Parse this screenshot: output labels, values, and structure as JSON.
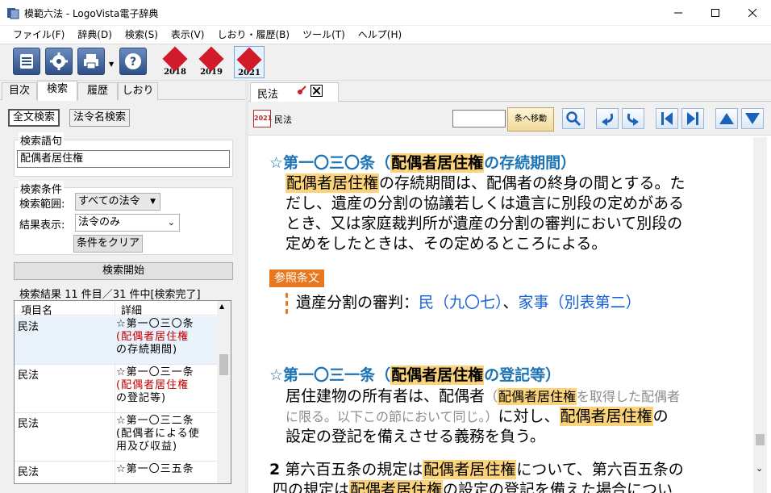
{
  "window": {
    "title": "模範六法 - LogoVista電子辞典",
    "controls": {
      "minimize": "—",
      "maximize": "☐",
      "close": "✕"
    }
  },
  "menu": [
    "ファイル(F)",
    "辞典(D)",
    "検索(S)",
    "表示(V)",
    "しおり・履歴(B)",
    "ツール(T)",
    "ヘルプ(H)"
  ],
  "toolbar": {
    "editions": [
      {
        "label": "模範六法",
        "year": "2018",
        "active": false
      },
      {
        "label": "模範六法",
        "year": "2019",
        "active": false
      },
      {
        "label": "模範六法",
        "year": "2021",
        "active": true
      }
    ],
    "icons": [
      "list-icon",
      "gear-icon",
      "printer-icon",
      "help-icon"
    ],
    "accent_color": "#2e4f86"
  },
  "left": {
    "tabs": [
      "目次",
      "検索",
      "履歴",
      "しおり"
    ],
    "active_tab": "検索",
    "subtabs": [
      "全文検索",
      "法令名検索"
    ],
    "active_subtab": "全文検索",
    "query_group": {
      "label": "検索語句",
      "value": "配偶者居住権"
    },
    "conditions": {
      "label": "検索条件",
      "range_label": "検索範囲:",
      "range_value": "すべての法令",
      "display_label": "結果表示:",
      "display_value": "法令のみ",
      "clear_button": "条件をクリア"
    },
    "search_button": "検索開始",
    "results_status": "検索結果 11 件目／31 件中[検索完了]",
    "results_headers": [
      "項目名",
      "詳細"
    ],
    "results": [
      {
        "name": "民法",
        "d1": "☆第一〇三〇条",
        "d2": "(配偶者居住権",
        "d3": "の存続期間)"
      },
      {
        "name": "民法",
        "d1": "☆第一〇三一条",
        "d2": "(配偶者居住権",
        "d3": "の登記等)"
      },
      {
        "name": "民法",
        "d1": "☆第一〇三二条",
        "d2": "(配偶者による使",
        "d3": "用及び収益)"
      },
      {
        "name": "民法",
        "d1": "☆第一〇三五条",
        "d2": "",
        "d3": ""
      }
    ]
  },
  "right": {
    "doc_tab": "民法",
    "doc_label": "民法",
    "doc_badge": "2021",
    "jump_placeholder": "",
    "jump_button": "条へ移動",
    "highlight_color": "#fbd37a",
    "article1": {
      "star": "☆",
      "num": "第一〇三〇条",
      "open": "（",
      "keyword": "配偶者居住権",
      "rest": "の存続期間）",
      "body_kw": "配偶者居住権",
      "body_line1": "の存続期間は、配偶者の終身の間とする。た",
      "body_line2": "だし、遺産の分割の協議若しくは遺言に別段の定めがある",
      "body_line3": "とき、又は家庭裁判所が遺産の分割の審判において別段の",
      "body_line4": "定めをしたときは、その定めるところによる。"
    },
    "reference": {
      "badge": "参照条文",
      "text": "遺産分割の審判：",
      "link1": "民（九〇七）",
      "sep": "、",
      "link2_a": "家事",
      "link2_b": "（別表第二）"
    },
    "article2": {
      "star": "☆",
      "num": "第一〇三一条",
      "open": "（",
      "keyword": "配偶者居住権",
      "rest": "の登記等）",
      "line1_a": "居住建物の所有者は、配偶者",
      "note_open": "（",
      "note_kw": "配偶者居住権",
      "note_a": "を取得した配偶者",
      "note_b": "に限る。以下この節において同じ。）",
      "line2_a": "に対し、",
      "line2_kw": "配偶者居住権",
      "line2_b": "の",
      "line3": "設定の登記を備えさせる義務を負う。"
    },
    "para2": {
      "num": "2",
      "text_a": "第六百五条の規定は",
      "kw": "配偶者居住権",
      "text_b": "について、第六百五条の",
      "line2_a": "四の規定は",
      "line2_kw": "配偶者居住権",
      "line2_b": "の設定の登記を備えた場合につい"
    }
  }
}
